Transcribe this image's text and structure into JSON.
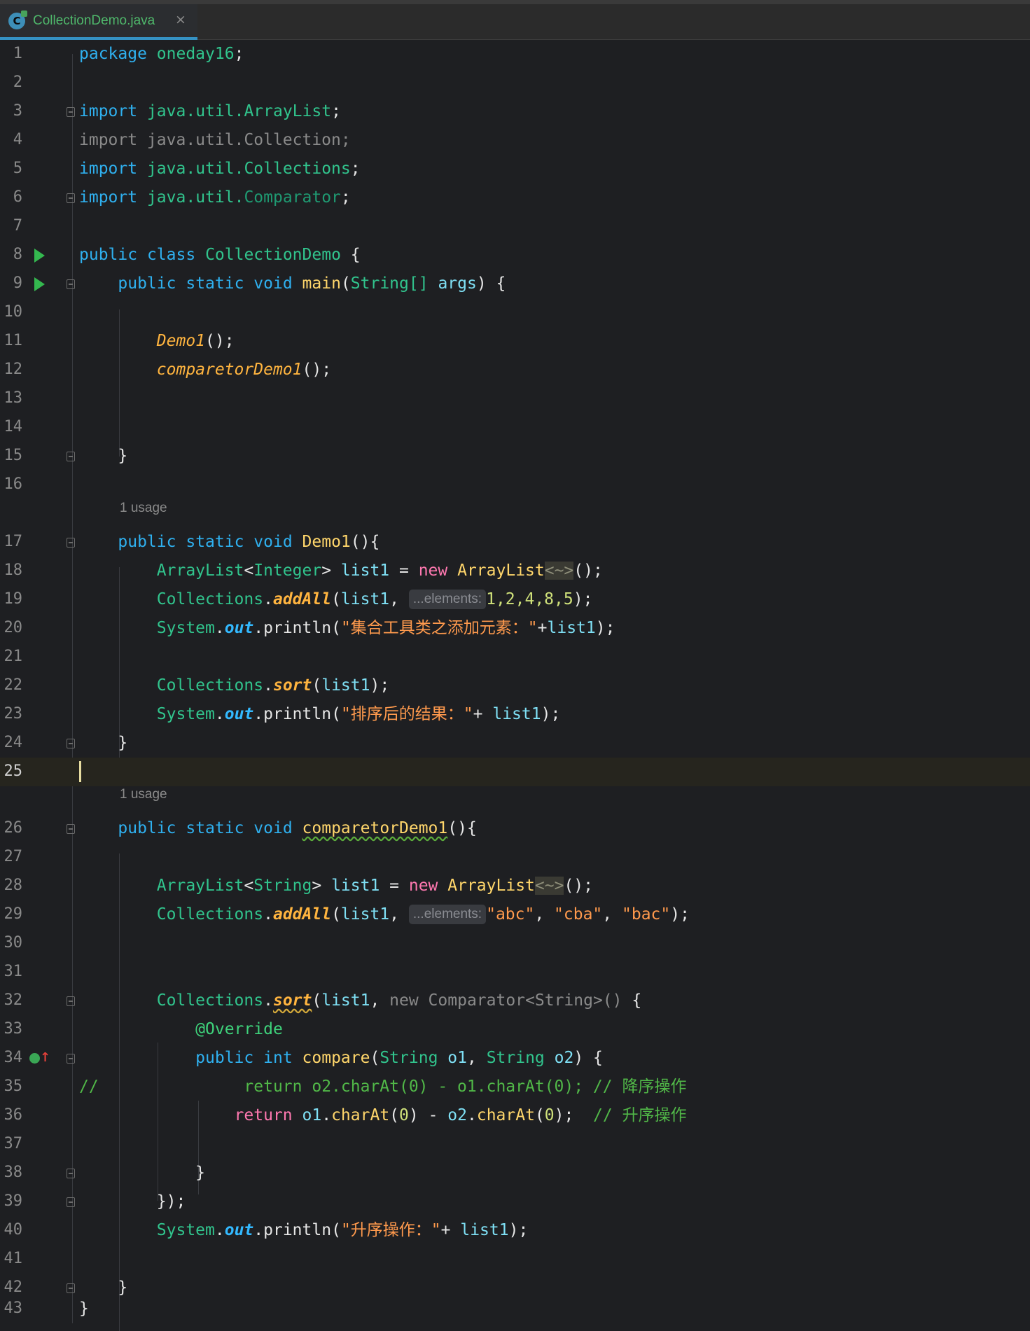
{
  "tab": {
    "icon_letter": "C",
    "filename": "CollectionDemo.java",
    "close": "×"
  },
  "lines": [
    {
      "n": "1"
    },
    {
      "n": "2"
    },
    {
      "n": "3"
    },
    {
      "n": "4"
    },
    {
      "n": "5"
    },
    {
      "n": "6"
    },
    {
      "n": "7"
    },
    {
      "n": "8"
    },
    {
      "n": "9"
    },
    {
      "n": "10"
    },
    {
      "n": "11"
    },
    {
      "n": "12"
    },
    {
      "n": "13"
    },
    {
      "n": "14"
    },
    {
      "n": "15"
    },
    {
      "n": "16"
    },
    {
      "n": "17"
    },
    {
      "n": "18"
    },
    {
      "n": "19"
    },
    {
      "n": "20"
    },
    {
      "n": "21"
    },
    {
      "n": "22"
    },
    {
      "n": "23"
    },
    {
      "n": "24"
    },
    {
      "n": "25"
    },
    {
      "n": "26"
    },
    {
      "n": "27"
    },
    {
      "n": "28"
    },
    {
      "n": "29"
    },
    {
      "n": "30"
    },
    {
      "n": "31"
    },
    {
      "n": "32"
    },
    {
      "n": "33"
    },
    {
      "n": "34"
    },
    {
      "n": "35"
    },
    {
      "n": "36"
    },
    {
      "n": "37"
    },
    {
      "n": "38"
    },
    {
      "n": "39"
    },
    {
      "n": "40"
    },
    {
      "n": "41"
    },
    {
      "n": "42"
    },
    {
      "n": "43"
    }
  ],
  "code": {
    "kw_package": "package",
    "pkg_name": "oneday16",
    "semi": ";",
    "kw_import": "import",
    "imp_java_util": "java.util.",
    "cls_arraylist": "ArrayList",
    "imp_collection_full": "import java.util.Collection;",
    "cls_collections": "Collections",
    "cls_comparator": "Comparator",
    "kw_public": "public",
    "kw_class": "class",
    "kw_static": "static",
    "kw_void": "void",
    "kw_int": "int",
    "kw_new": "new",
    "kw_return": "return",
    "cls_name": "CollectionDemo",
    "brace_open": "{",
    "brace_close": "}",
    "fn_main": "main",
    "type_string": "String",
    "arr_brackets": "[]",
    "param_args": "args",
    "call_demo1": "Demo1",
    "call_comparetor": "comparetorDemo1",
    "call_parens_semi": "();",
    "usage_hint": "1 usage",
    "fn_demo1": "Demo1",
    "fn_comparetor": "comparetorDemo1",
    "parens_brace": "(){",
    "type_integer": "Integer",
    "var_list1": "list1",
    "diamond": "<~>",
    "addAll": "addAll",
    "elements_hint": "...elements:",
    "nums": "1,2,4,8,5",
    "system": "System",
    "out": "out",
    "println": "println",
    "str_add": "\"集合工具类之添加元素：\"",
    "str_sorted": "\"排序后的结果：\"",
    "sort": "sort",
    "str_abc": "\"abc\"",
    "str_cba": "\"cba\"",
    "str_bac": "\"bac\"",
    "anon_comparator": "new Comparator<String>()",
    "ann_override": "@Override",
    "fn_compare": "compare",
    "param_o1": "o1",
    "param_o2": "o2",
    "comment_slashes": "//",
    "commented_return": "return o2.charAt(0) - o1.charAt(0); // 降序操作",
    "charAt": "charAt",
    "zero": "0",
    "comment_asc": "// 升序操作",
    "close_anon": "});",
    "str_asc": "\"升序操作：\""
  }
}
